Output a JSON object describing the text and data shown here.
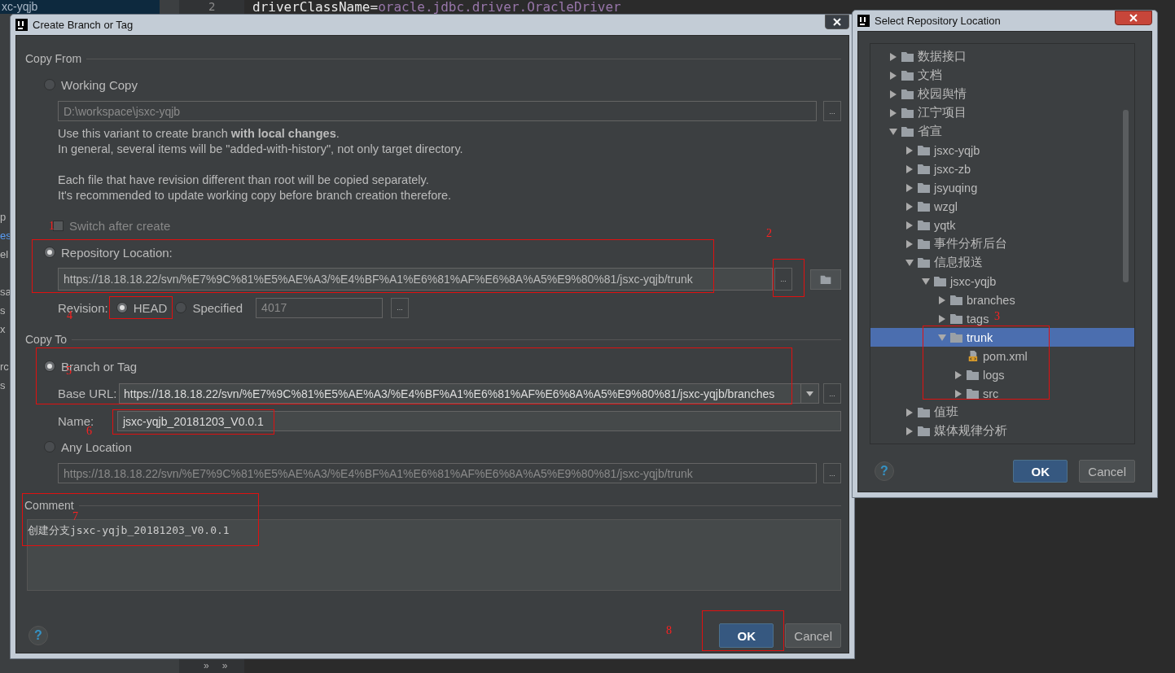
{
  "ide": {
    "project_item": "xc-yqjb",
    "line_number": "2",
    "code_key": "driverClassName",
    "code_eq": "=",
    "code_value": "oracle.jdbc.driver.OracleDriver",
    "panel_fragments": [
      "p",
      "es",
      "el",
      "sa",
      "s",
      "x",
      "rc",
      "s"
    ],
    "bottom_marks": [
      "»",
      "»"
    ]
  },
  "create_dialog": {
    "title": "Create Branch or Tag",
    "copy_from": {
      "heading": "Copy From",
      "working_copy": {
        "label": "Working Copy",
        "selected": false,
        "path": "D:\\workspace\\jsxc-yqjb",
        "browse": "..."
      },
      "notes": [
        [
          "Use this variant to create branch **with local changes**.",
          "In general, several items will be \"added-with-history\", not only target directory."
        ],
        [
          "Each file that have revision different than root will be copied separately.",
          "It's recommended to update working copy before branch creation therefore."
        ]
      ],
      "switch_after_create": {
        "label": "Switch after create",
        "checked": false,
        "disabled": true
      },
      "repository_location": {
        "label": "Repository Location:",
        "selected": true,
        "url": "https://18.18.18.22/svn/%E7%9C%81%E5%AE%A3/%E4%BF%A1%E6%81%AF%E6%8A%A5%E9%80%81/jsxc-yqjb/trunk",
        "browse": "..."
      },
      "revision": {
        "label": "Revision:",
        "options": [
          {
            "label": "HEAD",
            "selected": true
          },
          {
            "label": "Specified",
            "selected": false
          }
        ],
        "specified_value": "4017",
        "browse": "..."
      }
    },
    "copy_to": {
      "heading": "Copy To",
      "branch_or_tag": {
        "label": "Branch or Tag",
        "selected": true
      },
      "base_url_label": "Base URL:",
      "base_url": "https://18.18.18.22/svn/%E7%9C%81%E5%AE%A3/%E4%BF%A1%E6%81%AF%E6%8A%A5%E9%80%81/jsxc-yqjb/branches",
      "base_url_browse": "...",
      "name_label": "Name:",
      "name": "jsxc-yqjb_20181203_V0.0.1",
      "any_location": {
        "label": "Any Location",
        "selected": false
      },
      "any_location_url": "https://18.18.18.22/svn/%E7%9C%81%E5%AE%A3/%E4%BF%A1%E6%81%AF%E6%8A%A5%E9%80%81/jsxc-yqjb/trunk",
      "any_location_browse": "..."
    },
    "comment": {
      "heading": "Comment",
      "text": "创建分支jsxc-yqjb_20181203_V0.0.1"
    },
    "help_label": "?",
    "buttons": [
      {
        "label": "OK",
        "kind": "default"
      },
      {
        "label": "Cancel",
        "kind": "normal"
      }
    ]
  },
  "repo_dialog": {
    "title": "Select Repository Location",
    "tree": [
      {
        "label": "数据接口",
        "kind": "folder",
        "expanded": false,
        "selected": false
      },
      {
        "label": "文档",
        "kind": "folder",
        "expanded": false,
        "selected": false
      },
      {
        "label": "校园舆情",
        "kind": "folder",
        "expanded": false,
        "selected": false
      },
      {
        "label": "江宁项目",
        "kind": "folder",
        "expanded": false,
        "selected": false
      },
      {
        "label": "省宣",
        "kind": "folder",
        "expanded": true,
        "selected": false,
        "children": [
          {
            "label": "jsxc-yqjb",
            "kind": "folder",
            "expanded": false,
            "selected": false
          },
          {
            "label": "jsxc-zb",
            "kind": "folder",
            "expanded": false,
            "selected": false
          },
          {
            "label": "jsyuqing",
            "kind": "folder",
            "expanded": false,
            "selected": false
          },
          {
            "label": "wzgl",
            "kind": "folder",
            "expanded": false,
            "selected": false
          },
          {
            "label": "yqtk",
            "kind": "folder",
            "expanded": false,
            "selected": false
          },
          {
            "label": "事件分析后台",
            "kind": "folder",
            "expanded": false,
            "selected": false
          },
          {
            "label": "信息报送",
            "kind": "folder",
            "expanded": true,
            "selected": false,
            "children": [
              {
                "label": "jsxc-yqjb",
                "kind": "folder",
                "expanded": true,
                "selected": false,
                "children": [
                  {
                    "label": "branches",
                    "kind": "folder",
                    "expanded": false,
                    "selected": false
                  },
                  {
                    "label": "tags",
                    "kind": "folder",
                    "expanded": false,
                    "selected": false
                  },
                  {
                    "label": "trunk",
                    "kind": "folder",
                    "expanded": true,
                    "selected": true,
                    "children": [
                      {
                        "label": "pom.xml",
                        "kind": "file",
                        "selected": false
                      },
                      {
                        "label": "logs",
                        "kind": "folder",
                        "expanded": false,
                        "selected": false
                      },
                      {
                        "label": "src",
                        "kind": "folder",
                        "expanded": false,
                        "selected": false
                      }
                    ]
                  }
                ]
              }
            ]
          },
          {
            "label": "值班",
            "kind": "folder",
            "expanded": false,
            "selected": false
          },
          {
            "label": "媒体规律分析",
            "kind": "folder",
            "expanded": false,
            "selected": false
          }
        ]
      }
    ],
    "help_label": "?",
    "buttons": [
      {
        "label": "OK",
        "kind": "default"
      },
      {
        "label": "Cancel",
        "kind": "normal"
      }
    ]
  },
  "annotations": [
    {
      "label": "1"
    },
    {
      "label": "2"
    },
    {
      "label": "3"
    },
    {
      "label": "4"
    },
    {
      "label": "5"
    },
    {
      "label": "6"
    },
    {
      "label": "7"
    },
    {
      "label": "8"
    }
  ]
}
